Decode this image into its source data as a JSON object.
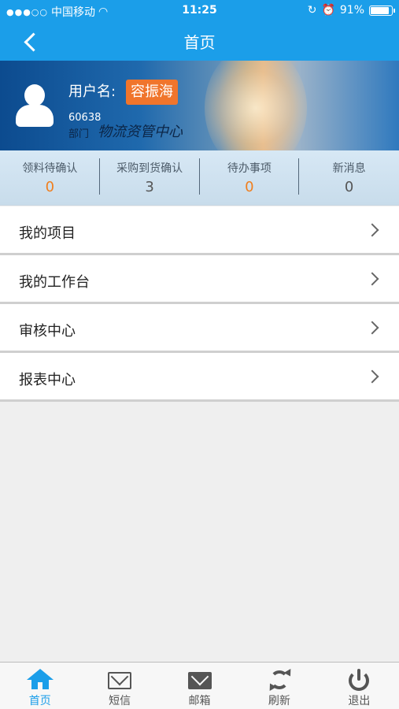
{
  "status": {
    "signal": "●●●○○",
    "carrier": "中国移动",
    "wifi_icon": "wifi-icon",
    "time": "11:25",
    "battery_percent_text": "91%",
    "battery_level": 0.91
  },
  "nav": {
    "back_icon": "chevron-left-icon",
    "title": "首页"
  },
  "profile": {
    "username_label": "用户名:",
    "username": "容振海",
    "user_id": "60638",
    "dept_label": "部门",
    "dept": "物流资管中心"
  },
  "stats": [
    {
      "label": "领料待确认",
      "value": "0",
      "color": "#f07f1e"
    },
    {
      "label": "采购到货确认",
      "value": "3",
      "color": "#555555"
    },
    {
      "label": "待办事项",
      "value": "0",
      "color": "#f07f1e"
    },
    {
      "label": "新消息",
      "value": "0",
      "color": "#555555"
    }
  ],
  "menu": [
    {
      "label": "我的项目"
    },
    {
      "label": "我的工作台"
    },
    {
      "label": "审核中心"
    },
    {
      "label": "报表中心"
    }
  ],
  "tabs": [
    {
      "label": "首页",
      "icon": "home-icon",
      "active": true
    },
    {
      "label": "短信",
      "icon": "mail-outline-icon"
    },
    {
      "label": "邮箱",
      "icon": "mail-solid-icon"
    },
    {
      "label": "刷新",
      "icon": "refresh-icon"
    },
    {
      "label": "退出",
      "icon": "power-icon"
    }
  ],
  "colors": {
    "accent": "#1b9ee9",
    "badge": "#f07f1e"
  }
}
